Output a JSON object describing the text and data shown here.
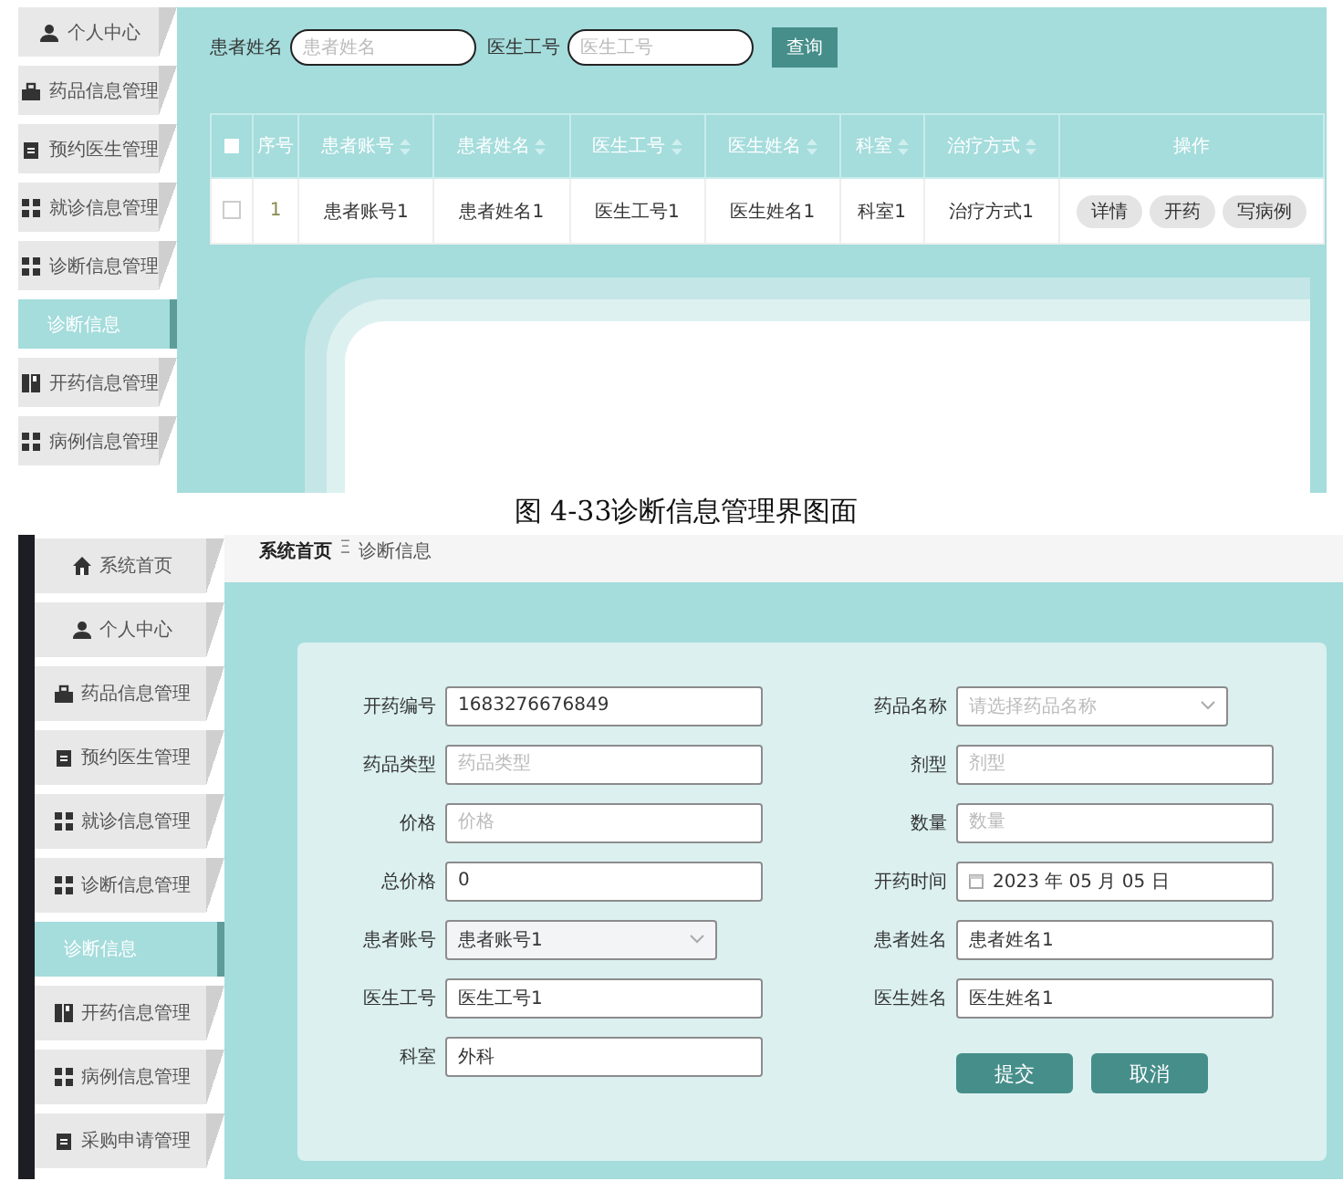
{
  "list_screen": {
    "sidebar": {
      "items": [
        {
          "label": "个人中心",
          "kind": "user",
          "selected": false
        },
        {
          "label": "药品信息管理",
          "kind": "case",
          "selected": false
        },
        {
          "label": "预约医生管理",
          "kind": "clipboard",
          "selected": false
        },
        {
          "label": "就诊信息管理",
          "kind": "grid",
          "selected": false
        },
        {
          "label": "诊断信息管理",
          "kind": "grid",
          "selected": false
        },
        {
          "label": "诊断信息",
          "kind": "sub",
          "selected": true
        },
        {
          "label": "开药信息管理",
          "kind": "book",
          "selected": false
        },
        {
          "label": "病例信息管理",
          "kind": "grid",
          "selected": false
        }
      ]
    },
    "search": {
      "fields": [
        {
          "label": "患者姓名",
          "placeholder": "患者姓名"
        },
        {
          "label": "医生工号",
          "placeholder": "医生工号"
        }
      ],
      "button": "查询"
    },
    "table": {
      "select_all_checked": false,
      "columns": [
        {
          "label": "序号",
          "sortable": false
        },
        {
          "label": "患者账号",
          "sortable": true
        },
        {
          "label": "患者姓名",
          "sortable": true
        },
        {
          "label": "医生工号",
          "sortable": true
        },
        {
          "label": "医生姓名",
          "sortable": true
        },
        {
          "label": "科室",
          "sortable": true
        },
        {
          "label": "治疗方式",
          "sortable": true
        },
        {
          "label": "操作",
          "sortable": false
        }
      ],
      "rows": [
        {
          "checked": false,
          "cells": [
            "1",
            "患者账号1",
            "患者姓名1",
            "医生工号1",
            "医生姓名1",
            "科室1",
            "治疗方式1"
          ],
          "actions": [
            "详情",
            "开药",
            "写病例"
          ]
        }
      ]
    }
  },
  "caption": "图 4-33诊断信息管理界图面",
  "form_screen": {
    "sidebar": {
      "items": [
        {
          "label": "系统首页",
          "kind": "home",
          "selected": false
        },
        {
          "label": "个人中心",
          "kind": "user",
          "selected": false
        },
        {
          "label": "药品信息管理",
          "kind": "case",
          "selected": false
        },
        {
          "label": "预约医生管理",
          "kind": "clipboard",
          "selected": false
        },
        {
          "label": "就诊信息管理",
          "kind": "grid",
          "selected": false
        },
        {
          "label": "诊断信息管理",
          "kind": "grid",
          "selected": false
        },
        {
          "label": "诊断信息",
          "kind": "sub",
          "selected": true
        },
        {
          "label": "开药信息管理",
          "kind": "book",
          "selected": false
        },
        {
          "label": "病例信息管理",
          "kind": "grid",
          "selected": false
        },
        {
          "label": "采购申请管理",
          "kind": "clipboard",
          "selected": false
        }
      ]
    },
    "breadcrumb": {
      "items": [
        "系统首页",
        "诊断信息"
      ],
      "separator": "Ξ"
    },
    "form": {
      "left": [
        {
          "label": "开药编号",
          "kind": "text",
          "value": "1683276676849",
          "disabled": false
        },
        {
          "label": "药品类型",
          "kind": "text",
          "placeholder": "药品类型",
          "disabled": false
        },
        {
          "label": "价格",
          "kind": "text",
          "placeholder": "价格",
          "disabled": false
        },
        {
          "label": "总价格",
          "kind": "text",
          "value": "0",
          "disabled": false
        },
        {
          "label": "患者账号",
          "kind": "select",
          "value": "患者账号1",
          "disabled": true
        },
        {
          "label": "医生工号",
          "kind": "text",
          "value": "医生工号1",
          "disabled": false
        },
        {
          "label": "科室",
          "kind": "text",
          "value": "外科",
          "disabled": false
        }
      ],
      "right": [
        {
          "label": "药品名称",
          "kind": "select",
          "placeholder": "请选择药品名称",
          "disabled": false
        },
        {
          "label": "剂型",
          "kind": "text",
          "placeholder": "剂型",
          "disabled": false
        },
        {
          "label": "数量",
          "kind": "text",
          "placeholder": "数量",
          "disabled": false
        },
        {
          "label": "开药时间",
          "kind": "date",
          "value": "2023 年 05 月 05 日",
          "disabled": false
        },
        {
          "label": "患者姓名",
          "kind": "text",
          "value": "患者姓名1",
          "disabled": false
        },
        {
          "label": "医生姓名",
          "kind": "text",
          "value": "医生姓名1",
          "disabled": false
        }
      ],
      "buttons": [
        "提交",
        "取消"
      ]
    }
  }
}
